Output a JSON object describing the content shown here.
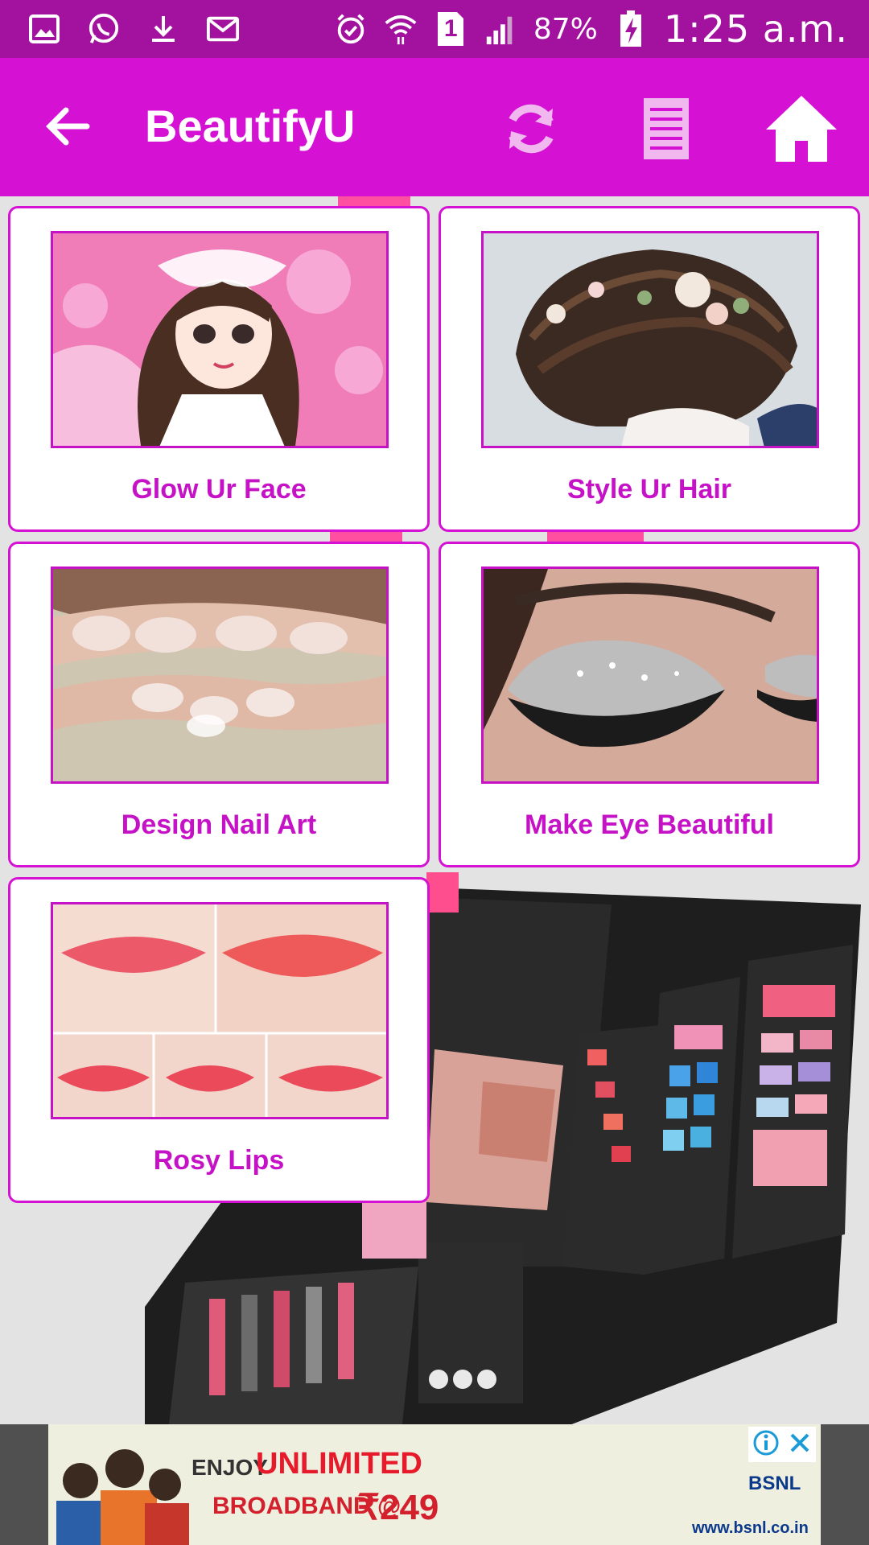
{
  "status_bar": {
    "battery": "87%",
    "time": "1:25 a.m.",
    "sim_slot": "1",
    "left_icons": [
      "gallery-icon",
      "whatsapp-icon",
      "download-icon",
      "gmail-icon"
    ],
    "right_icons": [
      "alarm-icon",
      "wifi-icon",
      "sim-icon",
      "signal-icon",
      "battery-charging-icon"
    ]
  },
  "toolbar": {
    "title": "BeautifyU",
    "actions": [
      "refresh-icon",
      "list-icon",
      "home-icon"
    ],
    "color": "#d512d3"
  },
  "categories": [
    {
      "label": "Glow Ur Face"
    },
    {
      "label": "Style Ur Hair"
    },
    {
      "label": "Design Nail Art"
    },
    {
      "label": "Make Eye Beautiful"
    },
    {
      "label": "Rosy Lips"
    }
  ],
  "ad": {
    "enjoy": "ENJOY",
    "unlimited": "UNLIMITED",
    "broadband": "BROADBAND @",
    "price": "₹249",
    "brand": "BSNL",
    "url": "www.bsnl.co.in"
  },
  "colors": {
    "status_bar": "#a3129e",
    "accent": "#d512d3",
    "label": "#c612c6"
  }
}
